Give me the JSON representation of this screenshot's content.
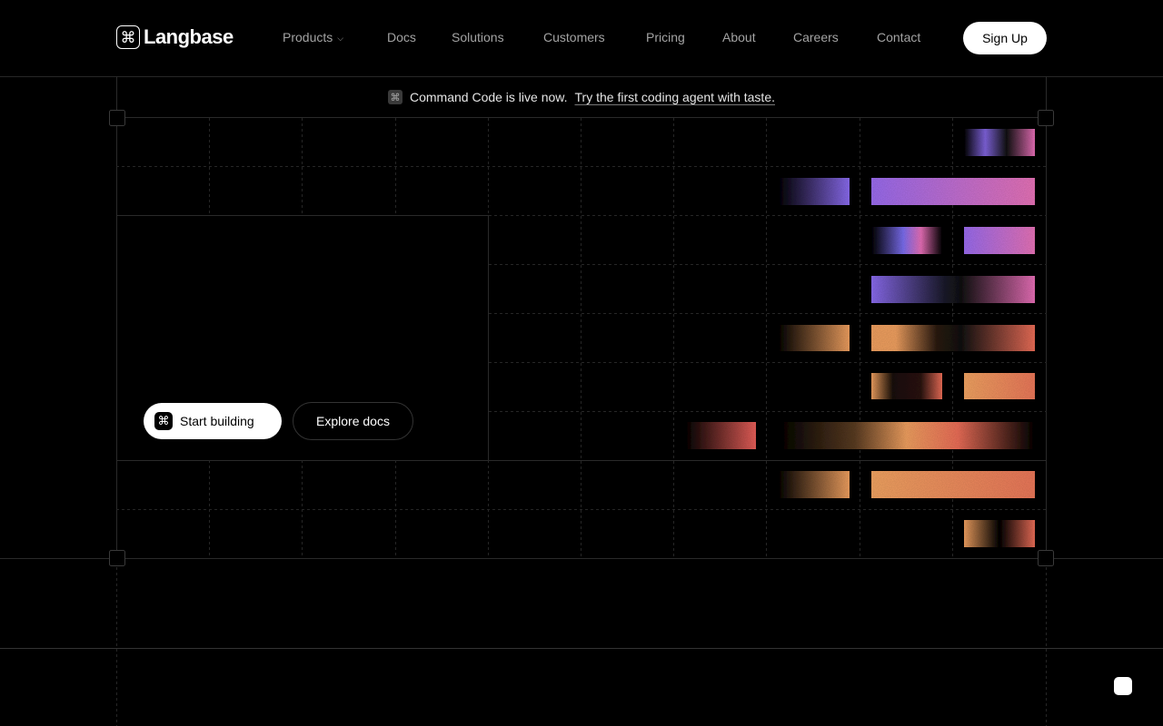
{
  "brand": {
    "name": "Langbase",
    "logo_icon": "command-icon"
  },
  "nav": {
    "items": [
      {
        "label": "Products",
        "has_dropdown": true
      },
      {
        "label": "Docs"
      },
      {
        "label": "Solutions"
      },
      {
        "label": "Customers"
      },
      {
        "label": "Pricing"
      },
      {
        "label": "About"
      },
      {
        "label": "Careers"
      },
      {
        "label": "Contact"
      }
    ],
    "signup_label": "Sign Up"
  },
  "announcement": {
    "icon": "command-icon",
    "text": "Command Code is live now.",
    "link": "Try the first coding agent with taste."
  },
  "hero": {
    "primary_cta": "Start building",
    "secondary_cta": "Explore docs"
  },
  "colors": {
    "background": "#000000",
    "purple": "#8b6cf0",
    "pink": "#e86fb8",
    "orange": "#f0a060",
    "coral": "#e9705a"
  }
}
